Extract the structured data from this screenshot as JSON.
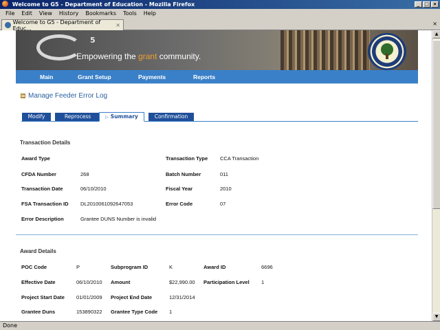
{
  "window": {
    "title": "Welcome to G5 - Department of Education - Mozilla Firefox"
  },
  "menu": [
    "File",
    "Edit",
    "View",
    "History",
    "Bookmarks",
    "Tools",
    "Help"
  ],
  "browser_tab": {
    "title": "Welcome to G5 - Department of Educ..."
  },
  "status": "Done",
  "banner": {
    "logo_text": "G",
    "logo_sup": "5",
    "tagline_pre": "Empowering the ",
    "tagline_accent": "grant",
    "tagline_post": " community."
  },
  "nav": [
    "Main",
    "Grant Setup",
    "Payments",
    "Reports"
  ],
  "page_title": "Manage Feeder Error Log",
  "subtabs": {
    "modify": "Modify",
    "reprocess": "Reprocess",
    "summary": "Summary",
    "confirmation": "Confirmation"
  },
  "transaction": {
    "heading": "Transaction Details",
    "award_type_label": "Award Type",
    "award_type_value": "",
    "transaction_type_label": "Transaction Type",
    "transaction_type_value": "CCA Transaction",
    "cfda_label": "CFDA Number",
    "cfda_value": "268",
    "batch_label": "Batch Number",
    "batch_value": "011",
    "date_label": "Transaction Date",
    "date_value": "06/10/2010",
    "fiscal_label": "Fiscal Year",
    "fiscal_value": "2010",
    "fsa_label": "FSA Transaction ID",
    "fsa_value": "DL2010061092647053",
    "error_code_label": "Error Code",
    "error_code_value": "07",
    "error_desc_label": "Error Description",
    "error_desc_value": "Grantee DUNS Number is invalid"
  },
  "award": {
    "heading": "Award Details",
    "poc_label": "POC Code",
    "poc_value": "P",
    "subprogram_label": "Subprogram ID",
    "subprogram_value": "K",
    "award_id_label": "Award ID",
    "award_id_value": "6696",
    "effective_label": "Effective Date",
    "effective_value": "06/10/2010",
    "amount_label": "Amount",
    "amount_value": "$22,990.00",
    "participation_label": "Participation Level",
    "participation_value": "1",
    "start_label": "Project Start Date",
    "start_value": "01/01/2009",
    "end_label": "Project End Date",
    "end_value": "12/31/2014",
    "duns_label": "Grantee Duns",
    "duns_value": "153890322",
    "grantee_type_label": "Grantee Type Code",
    "grantee_type_value": "1"
  }
}
